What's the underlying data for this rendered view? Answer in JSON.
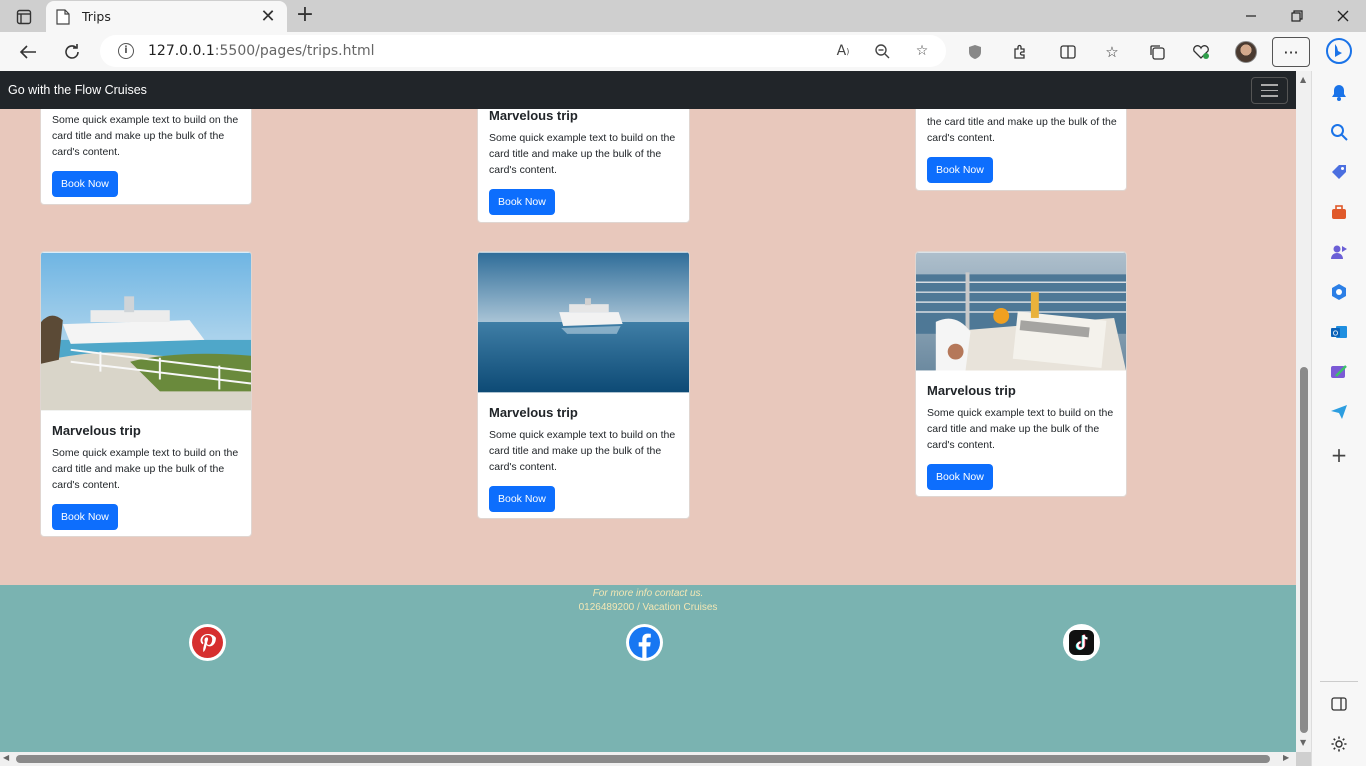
{
  "browser": {
    "tab_title": "Trips",
    "new_tab_symbol": "+",
    "close_symbol": "✕",
    "url_host": "127.0.0.1",
    "url_rest": ":5500/pages/trips.html",
    "more_symbol": "···"
  },
  "navbar": {
    "brand": "Go with the Flow Cruises"
  },
  "cards": [
    {
      "title": "",
      "text": "Some quick example text to build on the card title and make up the bulk of the card's content.",
      "button": "Book Now"
    },
    {
      "title": "Marvelous trip",
      "text": "Some quick example text to build on the card title and make up the bulk of the card's content.",
      "button": "Book Now"
    },
    {
      "title": "",
      "text": "the card title and make up the bulk of the card's content.",
      "button": "Book Now"
    },
    {
      "title": "Marvelous trip",
      "text": "Some quick example text to build on the card title and make up the bulk of the card's content.",
      "button": "Book Now"
    },
    {
      "title": "Marvelous trip",
      "text": "Some quick example text to build on the card title and make up the bulk of the card's content.",
      "button": "Book Now"
    },
    {
      "title": "Marvelous trip",
      "text": "Some quick example text to build on the card title and make up the bulk of the card's content.",
      "button": "Book Now"
    }
  ],
  "footer": {
    "contact": "For more info contact us.",
    "phone": "0126489200 / Vacation Cruises",
    "social": [
      "pinterest-icon",
      "facebook-icon",
      "tiktok-icon"
    ]
  },
  "colors": {
    "page_bg": "#e8c8bc",
    "navbar_bg": "#212529",
    "button": "#0d6efd",
    "footer_bg": "#7ab3b1",
    "footer_text": "#f3e7b5"
  }
}
